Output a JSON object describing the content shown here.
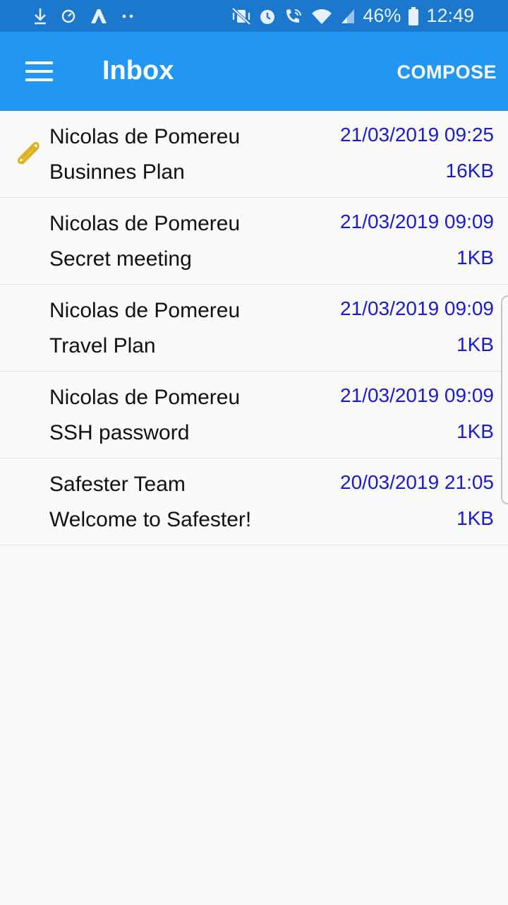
{
  "status_bar": {
    "battery_percent": "46%",
    "time": "12:49",
    "icons": [
      "download-icon",
      "speed-icon",
      "app-a-icon",
      "more-dots-icon",
      "vibrate-icon",
      "alarm-icon",
      "wifi-call-icon",
      "wifi-icon",
      "signal-icon",
      "battery-icon"
    ]
  },
  "app_bar": {
    "title": "Inbox",
    "compose_label": "COMPOSE",
    "background": "#2196f3"
  },
  "messages": [
    {
      "sender": "Nicolas de Pomereu",
      "subject": "Businnes Plan",
      "date": "21/03/2019 09:25",
      "size": "16KB",
      "attachment": true
    },
    {
      "sender": "Nicolas de Pomereu",
      "subject": "Secret meeting",
      "date": "21/03/2019 09:09",
      "size": "1KB",
      "attachment": false
    },
    {
      "sender": "Nicolas de Pomereu",
      "subject": "Travel Plan",
      "date": "21/03/2019 09:09",
      "size": "1KB",
      "attachment": false
    },
    {
      "sender": "Nicolas de Pomereu",
      "subject": "SSH password",
      "date": "21/03/2019 09:09",
      "size": "1KB",
      "attachment": false
    },
    {
      "sender": "Safester Team",
      "subject": "Welcome to Safester!",
      "date": "20/03/2019 21:05",
      "size": "1KB",
      "attachment": false
    }
  ],
  "colors": {
    "status_bar": "#1c78cc",
    "meta_text": "#1a1ad1",
    "attachment_icon": "#e0b020"
  }
}
